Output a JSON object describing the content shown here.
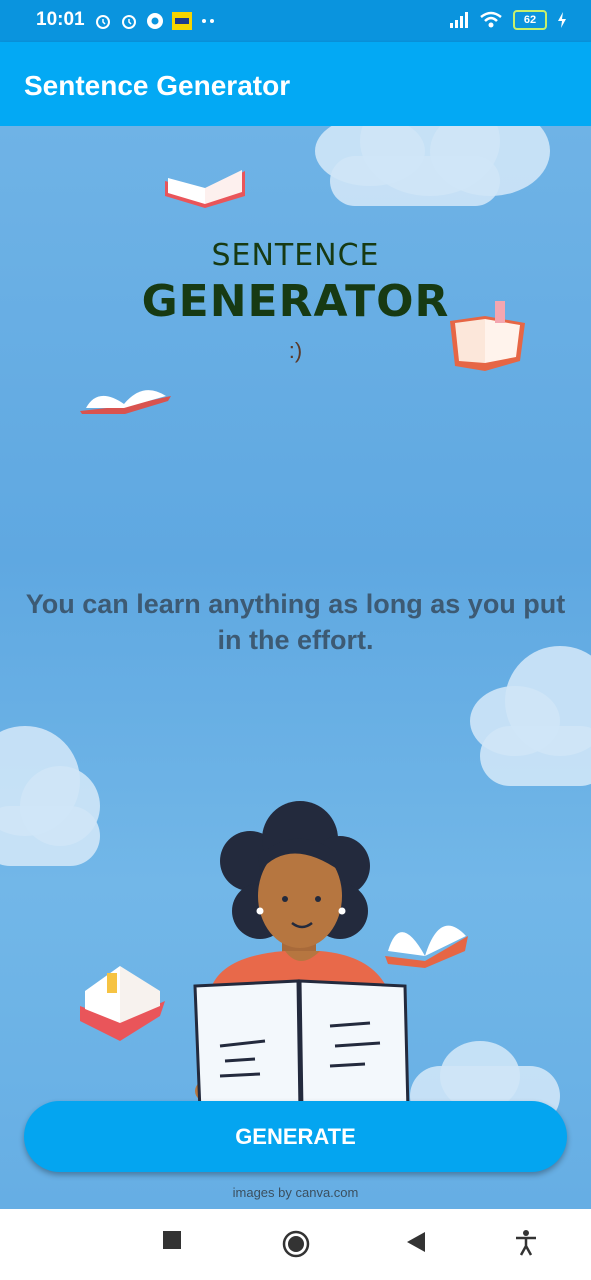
{
  "status": {
    "time": "10:01",
    "battery": "62",
    "icons": [
      "alarm-icon",
      "alarm-icon",
      "chrome-icon",
      "paytm-icon",
      "dots-icon",
      "signal-icon",
      "wifi-icon",
      "battery-icon",
      "charging-icon"
    ]
  },
  "appbar": {
    "title": "Sentence Generator",
    "color": "#03a9f4"
  },
  "logo": {
    "line1": "SENTENCE",
    "line2": "GENERATOR",
    "smile": ":)"
  },
  "quote": "You can learn anything as long as you put in the effort.",
  "button": {
    "label": "GENERATE",
    "color": "#04a5f0"
  },
  "credit": "images by canva.com",
  "nav": {
    "items": [
      "square-icon",
      "home-circle-icon",
      "back-triangle-icon",
      "accessibility-icon"
    ]
  }
}
